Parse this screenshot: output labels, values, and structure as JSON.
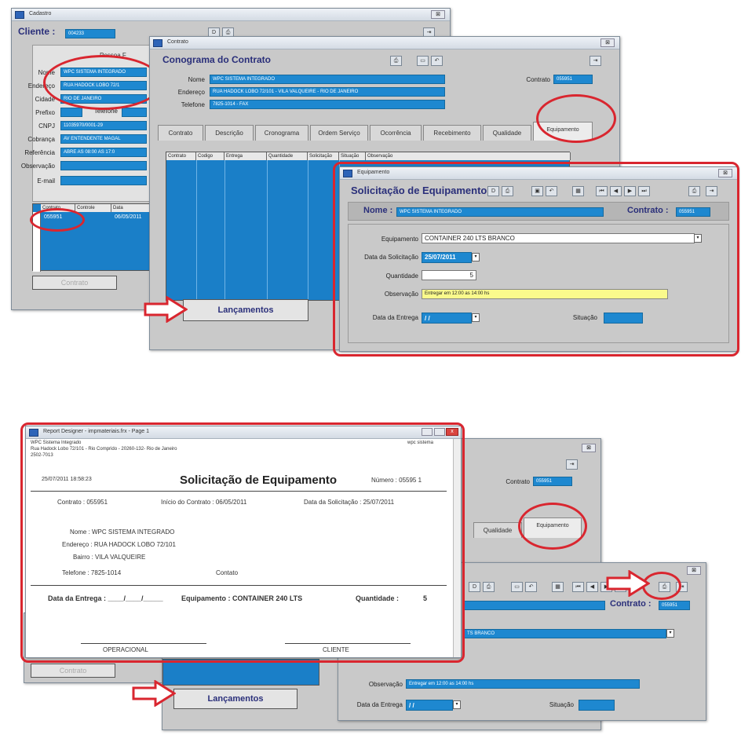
{
  "top": {
    "cadastro": {
      "title": "Cadastro",
      "cliente_label": "Cliente :",
      "cliente_value": "004233",
      "pessoa": "Pessoa F",
      "labels": [
        "Nome",
        "Endereço",
        "Cidade",
        "Prefixo",
        "CNPJ",
        "Cobrança",
        "Referência",
        "Observação",
        "E-mail"
      ],
      "values": [
        "WPC SISTEMA INTEGRADO",
        "RUA HADOCK LOBO 72/1",
        "RIO DE JANEIRO",
        "",
        "11035970/0001-29",
        "AV ENTENDENTE MAGAL",
        "ABRE AS 08:00 AS 17:0",
        "",
        ""
      ],
      "telefone_label": "Telefone",
      "grid_headers": [
        "Contrato",
        "Controle",
        "Data"
      ],
      "grid_row": [
        "055951",
        "",
        "06/05/2011"
      ],
      "contrato_button": "Contrato"
    },
    "contrato": {
      "title": "Contrato",
      "header": "Conograma do Contrato",
      "nome_label": "Nome",
      "nome_value": "WPC SISTEMA INTEGRADO",
      "endereco_label": "Endereço",
      "endereco_value": "RUA HADOCK LOBO 72/101 - VILA VALQUEIRE - RIO DE JANEIRO",
      "telefone_label": "Telefone",
      "telefone_value": "7825-1014 - FAX",
      "contrato_label": "Contrato",
      "contrato_value": "055951",
      "tabs": [
        "Contrato",
        "Descrição",
        "Cronograma",
        "Ordem Serviço",
        "Ocorrência",
        "Recebimento",
        "Qualidade",
        "Equipamento"
      ],
      "grid_headers": [
        "Contrato",
        "Codigo",
        "Entrega",
        "Quantidade",
        "Solicitação",
        "Situação",
        "Observação"
      ],
      "lancamentos": "Lançamentos"
    },
    "equip": {
      "title": "Equipamento",
      "header": "Solicitação de Equipamento",
      "nome_label": "Nome :",
      "nome_value": "WPC SISTEMA INTEGRADO",
      "contrato_label": "Contrato :",
      "contrato_value": "055951",
      "equip_label": "Equipamento",
      "equip_value": "CONTAINER 240 LTS BRANCO",
      "data_sol_label": "Data da Solicitação",
      "data_sol_value": "25/07/2011",
      "qtd_label": "Quantidade",
      "qtd_value": "5",
      "obs_label": "Observação",
      "obs_value": "Entregar em 12:00 as 14:00 hs",
      "data_ent_label": "Data da Entrega",
      "data_ent_value": "/ /",
      "sit_label": "Situação"
    }
  },
  "bottom": {
    "report": {
      "title": "Report Designer - impmateriais.frx - Page 1",
      "company": "WPC Sistema Integrado",
      "address": "Rua Hadock Lobo 72/101 - Rio Comprido - 20260-132- Rio de Janeiro",
      "phone": "2502-7013",
      "right_top": "wpc sistema",
      "datetime": "25/07/2011  18:58:23",
      "heading": "Solicitação de Equipamento",
      "numero": "Número : 05595 1",
      "contrato": "Contrato : 055951",
      "inicio": "Início do Contrato : 06/05/2011",
      "data_sol": "Data da Solicitação : 25/07/2011",
      "nome": "Nome : WPC SISTEMA INTEGRADO",
      "endereco": "Endereço : RUA HADOCK LOBO 72/101",
      "bairro": "Bairro : VILA VALQUEIRE",
      "telefone": "Telefone : 7825-1014",
      "contato": "Contato",
      "data_entrega": "Data da Entrega  :  ____/____/_____",
      "equipamento": "Equipamento : CONTAINER 240 LTS",
      "quantidade": "Quantidade :",
      "qtd": "5",
      "sign1": "OPERACIONAL",
      "sign2": "CLIENTE"
    },
    "contrato_bg": {
      "contrato_label": "Contrato",
      "contrato_value": "055951",
      "tabs": [
        "Qualidade",
        "Equipamento"
      ],
      "lancamentos": "Lançamentos",
      "contrato_button": "Contrato"
    },
    "equip_bg": {
      "contrato_label": "Contrato :",
      "contrato_value": "055951",
      "equip_value": "TS BRANCO",
      "obs_label": "Observação",
      "obs_value": "Entregar em 12:00 as 14:00 hs",
      "data_ent_label": "Data da Entrega",
      "data_ent_value": "/ /",
      "sit_label": "Situação"
    }
  }
}
